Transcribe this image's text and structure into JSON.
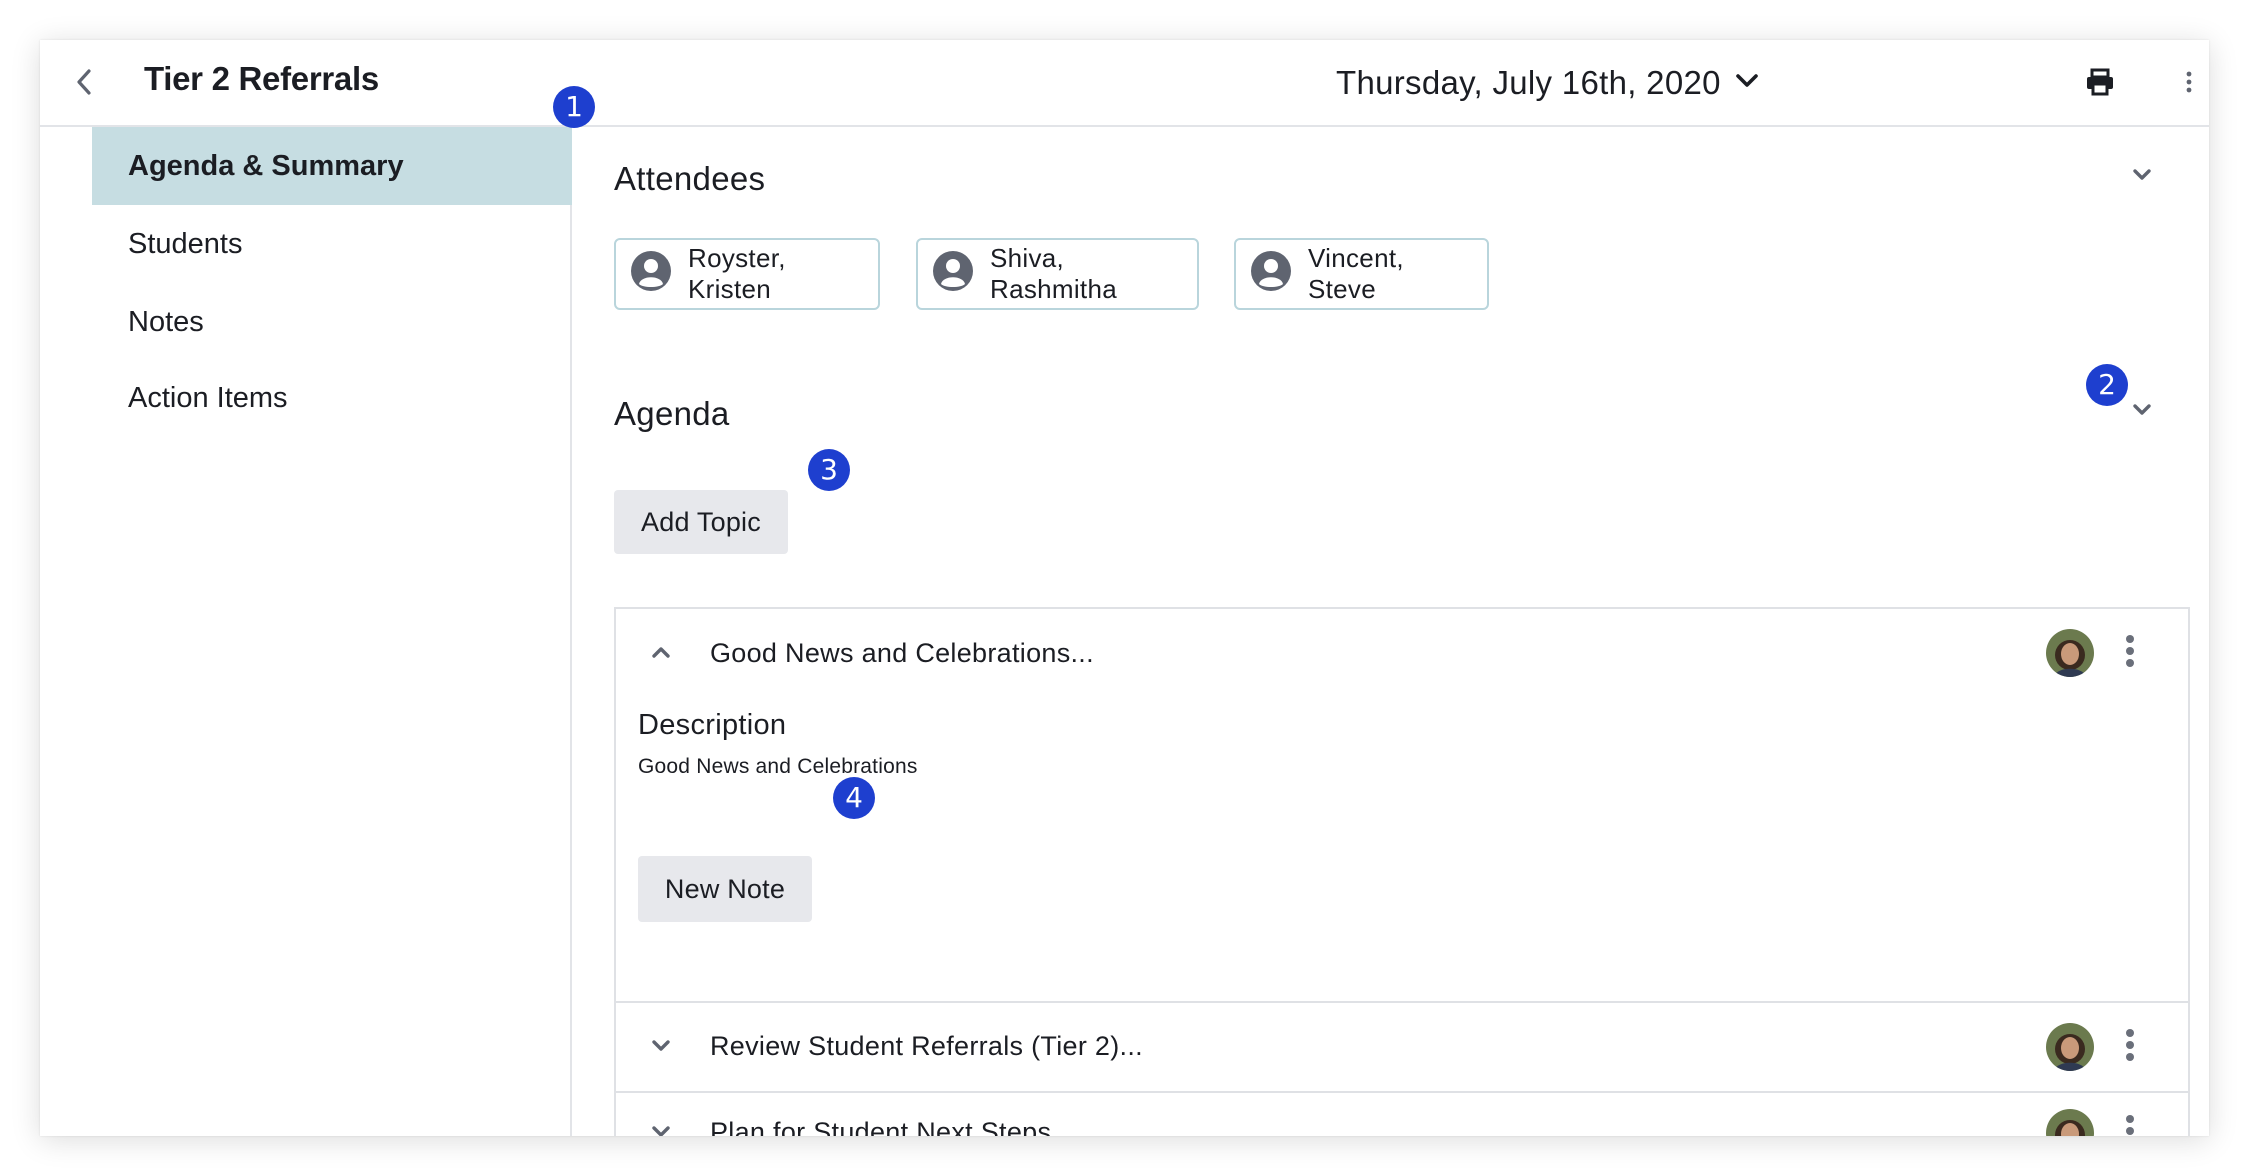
{
  "header": {
    "title": "Tier 2 Referrals",
    "date": "Thursday, July 16th, 2020",
    "back_icon": "chevron-left-icon",
    "print_icon": "printer-icon",
    "more_icon": "kebab-menu-icon"
  },
  "sidebar": {
    "items": [
      {
        "label": "Agenda & Summary",
        "active": true
      },
      {
        "label": "Students",
        "active": false
      },
      {
        "label": "Notes",
        "active": false
      },
      {
        "label": "Action Items",
        "active": false
      }
    ]
  },
  "attendees": {
    "title": "Attendees",
    "people": [
      "Royster, Kristen",
      "Shiva, Rashmitha",
      "Vincent, Steve"
    ]
  },
  "agenda": {
    "title": "Agenda",
    "add_topic_label": "Add Topic",
    "topics": [
      {
        "title": "Good News and Celebrations...",
        "expanded": true,
        "description_heading": "Description",
        "description": "Good News and Celebrations",
        "new_note_label": "New Note"
      },
      {
        "title": "Review Student Referrals (Tier 2)...",
        "expanded": false
      },
      {
        "title": "Plan for Student Next Steps...",
        "expanded": false
      }
    ]
  },
  "callouts": [
    "1",
    "2",
    "3",
    "4"
  ],
  "colors": {
    "active_nav_bg": "#c6dde2",
    "chip_border": "#b9d5dc",
    "button_bg": "#e7e8ec",
    "callout_badge": "#1e3fcf"
  }
}
